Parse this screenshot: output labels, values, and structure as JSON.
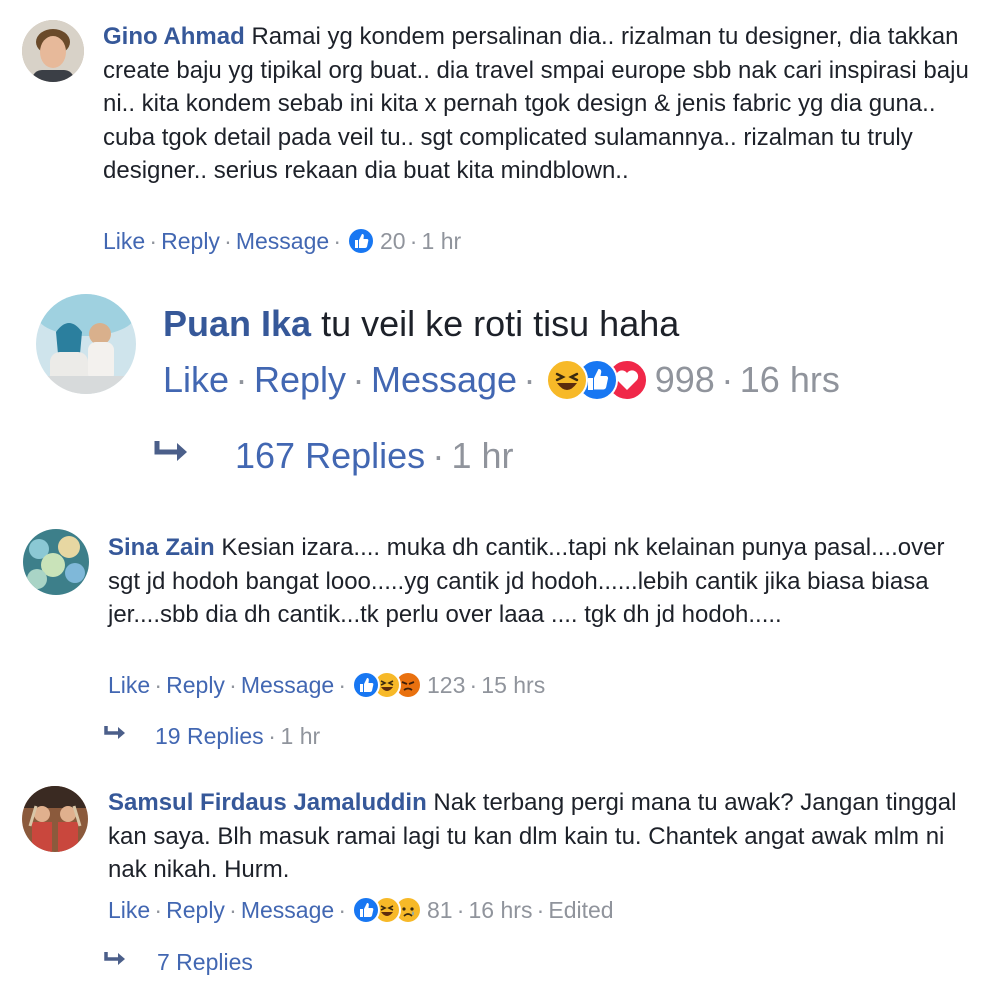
{
  "comments": [
    {
      "name": "Gino Ahmad",
      "text": "Ramai yg kondem persalinan dia.. rizalman tu designer, dia takkan create baju yg tipikal org buat.. dia travel smpai europe sbb nak cari inspirasi baju ni.. kita kondem sebab ini kita x pernah tgok design & jenis fabric yg dia guna.. cuba tgok detail pada veil tu.. sgt complicated sulamannya.. rizalman tu truly designer.. serius rekaan dia buat kita mindblown..",
      "actions": {
        "like": "Like",
        "reply": "Reply",
        "message": "Message"
      },
      "reaction_count": "20",
      "time": "1 hr"
    },
    {
      "name": "Puan Ika",
      "text": "tu veil ke roti tisu haha",
      "actions": {
        "like": "Like",
        "reply": "Reply",
        "message": "Message"
      },
      "reaction_count": "998",
      "time": "16 hrs",
      "replies": {
        "label": "167 Replies",
        "time": "1 hr"
      }
    },
    {
      "name": "Sina Zain",
      "text": "Kesian izara.... muka dh cantik...tapi nk kelainan punya pasal....over sgt jd hodoh bangat looo.....yg cantik jd hodoh......lebih cantik jika biasa biasa jer....sbb dia dh cantik...tk perlu over laaa .... tgk dh jd hodoh.....",
      "actions": {
        "like": "Like",
        "reply": "Reply",
        "message": "Message"
      },
      "reaction_count": "123",
      "time": "15 hrs",
      "replies": {
        "label": "19 Replies",
        "time": "1 hr"
      }
    },
    {
      "name": "Samsul Firdaus Jamaluddin",
      "text": "Nak terbang pergi mana tu awak? Jangan tinggal kan saya. Blh masuk ramai lagi tu kan dlm kain tu. Chantek angat awak mlm ni nak nikah. Hurm.",
      "actions": {
        "like": "Like",
        "reply": "Reply",
        "message": "Message"
      },
      "reaction_count": "81",
      "time": "16 hrs",
      "edited": "Edited",
      "replies": {
        "label": "7 Replies"
      }
    }
  ],
  "dot": "·",
  "icons": {
    "reply_arrow": "reply-arrow-icon",
    "like": "like-reaction-icon",
    "haha": "haha-reaction-icon",
    "love": "love-reaction-icon",
    "angry": "angry-reaction-icon",
    "sad": "sad-reaction-icon"
  },
  "colors": {
    "name": "#365899",
    "link": "#4267b2",
    "meta": "#90949c",
    "like_blue": "#1877f2",
    "haha_yellow": "#f7b928",
    "love_red": "#f02849",
    "angry_orange": "#e9710f"
  }
}
